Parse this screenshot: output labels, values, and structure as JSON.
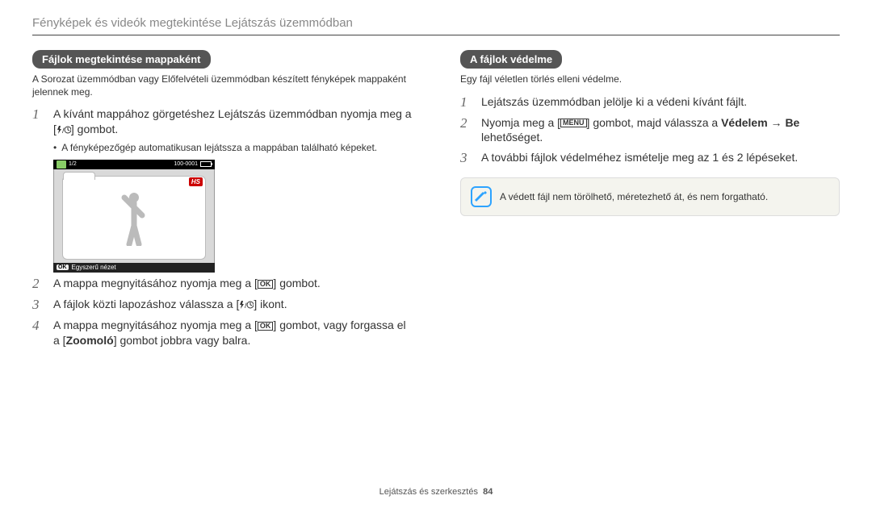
{
  "header": "Fényképek és videók megtekintése Lejátszás üzemmódban",
  "left": {
    "pill": "Fájlok megtekintése mappaként",
    "desc": "A Sorozat üzemmódban vagy Előfelvételi üzemmódban készített fényképek mappaként jelennek meg.",
    "step1_a": "A kívánt mappához görgetéshez Lejátszás üzemmódban nyomja meg a [",
    "step1_b": "] gombot.",
    "bullet": "A fényképezőgép automatikusan lejátssza a mappában található képeket.",
    "screenshot": {
      "counter": "1/2",
      "fileno": "100-0001",
      "hs": "HS",
      "ok": "OK",
      "label": "Egyszerű nézet"
    },
    "step2_a": "A mappa megnyitásához nyomja meg a [",
    "step2_b": "] gombot.",
    "step3_a": "A fájlok közti lapozáshoz válassza a [",
    "step3_b": "] ikont.",
    "step4_a": "A mappa megnyitásához nyomja meg a [",
    "step4_b": "] gombot, vagy forgassa el a [",
    "step4_bold": "Zoomoló",
    "step4_c": "] gombot jobbra vagy balra."
  },
  "right": {
    "pill": "A fájlok védelme",
    "desc": "Egy fájl véletlen törlés elleni védelme.",
    "step1": "Lejátszás üzemmódban jelölje ki a védeni kívánt fájlt.",
    "step2_a": "Nyomja meg a [",
    "step2_b": "] gombot, majd válassza a ",
    "step2_bold": "Védelem → Be",
    "step2_c": " lehetőséget.",
    "step3": "A további fájlok védelméhez ismételje meg az 1 és 2 lépéseket.",
    "note": "A védett fájl nem törölhető, méretezhető át, és nem forgatható."
  },
  "footer_a": "Lejátszás és szerkesztés",
  "footer_b": "84"
}
